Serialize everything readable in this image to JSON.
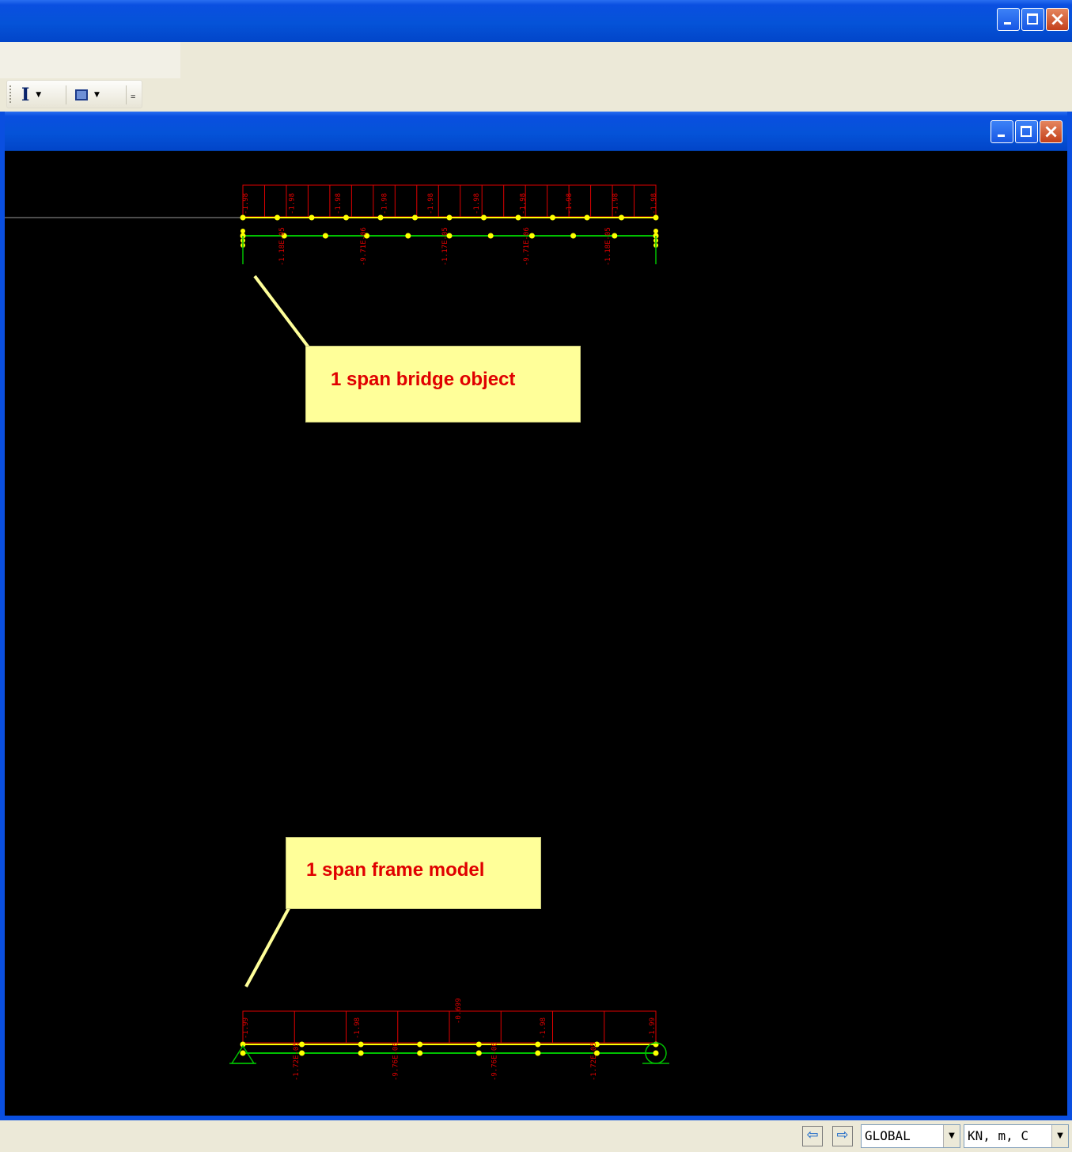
{
  "window": {
    "title": "",
    "controls": [
      "minimize",
      "maximize",
      "close"
    ]
  },
  "toolbar": {
    "items": [
      {
        "icon": "text-cursor-icon",
        "glyph": "I",
        "has_dropdown": true
      },
      {
        "icon": "display-box-icon",
        "has_dropdown": true
      }
    ],
    "overflow_glyph": "=",
    "dropdown_glyph": "▼"
  },
  "view_window": {
    "title": "",
    "controls": [
      "minimize",
      "maximize",
      "close"
    ]
  },
  "canvas": {
    "background": "#000000",
    "structure_color": "#00c000",
    "joint_color": "#ffff00",
    "load_color": "#e00000",
    "callouts": [
      {
        "text": "1 span bridge object"
      },
      {
        "text": "1 span frame model"
      }
    ],
    "bridge_object": {
      "load_labels": [
        "-1.98",
        "-1.98",
        "-1.98",
        "-1.98",
        "-1.98",
        "-1.98",
        "-1.98",
        "-1.98",
        "-1.98",
        "-1.98"
      ],
      "moment_labels": [
        "-1.18E-05",
        "-9.71E-06",
        "-1.17E-05",
        "-9.71E-06",
        "-1.18E-05"
      ]
    },
    "frame_model": {
      "load_labels": [
        "-1.99",
        "-1.98",
        "-1.98",
        "-1.99"
      ],
      "moment_labels": [
        "-1.72E-05",
        "-9.76E-06",
        "-9.76E-06",
        "-1.72E-05"
      ],
      "mid_label": "-0.699"
    }
  },
  "statusbar": {
    "prev_glyph": "⇦",
    "next_glyph": "⇨",
    "coord_system": "GLOBAL",
    "units": "KN, m, C"
  }
}
